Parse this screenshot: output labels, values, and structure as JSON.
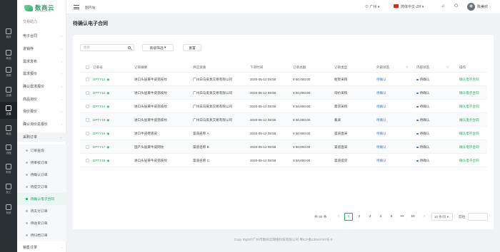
{
  "rail": [
    {
      "label": "首页",
      "icon": "home-icon"
    },
    {
      "label": "商品",
      "icon": "goods-icon"
    },
    {
      "label": "资质",
      "icon": "license-icon"
    },
    {
      "label": "店铺",
      "icon": "shop-icon"
    },
    {
      "label": "交易",
      "icon": "trade-icon"
    },
    {
      "label": "商品",
      "icon": "product-icon"
    },
    {
      "label": "流程",
      "icon": "flow-icon"
    },
    {
      "label": "财务",
      "icon": "finance-icon"
    },
    {
      "label": "加工",
      "icon": "process-icon"
    },
    {
      "label": "系统",
      "icon": "system-icon"
    }
  ],
  "brand": {
    "name": "数商云",
    "sub": "SHU SHANG YUN"
  },
  "menu": {
    "heading": "交易助力",
    "items": [
      {
        "label": "电子合同"
      },
      {
        "label": "进销存"
      },
      {
        "label": "需求发布"
      },
      {
        "label": "需求报价"
      },
      {
        "label": "确认需求报价"
      },
      {
        "label": "商品询价"
      },
      {
        "label": "询价报价"
      },
      {
        "label": "确认询价总报价"
      }
    ],
    "group": "采购订单",
    "sub_items": [
      {
        "label": "订单查询"
      },
      {
        "label": "待审核订单"
      },
      {
        "label": "待确认订单"
      },
      {
        "label": "待提交订单"
      },
      {
        "label": "待确认电子合同"
      },
      {
        "label": "待支付订单"
      },
      {
        "label": "待收货订单"
      },
      {
        "label": "待归档订单"
      }
    ],
    "last": "销售订单"
  },
  "topbar": {
    "station": "国内站",
    "location": "广州",
    "language": "简体中文-ZH",
    "username": "陈美欣"
  },
  "page": {
    "title": "待确认电子合同"
  },
  "toolbar": {
    "search_placeholder": "搜索",
    "advanced": "高级筛选",
    "reset": "重置"
  },
  "table": {
    "headers": [
      "订单号",
      "订单摘要",
      "供应资质",
      "下单时间",
      "订单总额",
      "订单类型",
      "外部状态",
      "内部状态",
      "操作"
    ],
    "rows": [
      {
        "id": "DPTY12",
        "summary": "进口头层黄牛皮荔枝纹",
        "supplier": "广州白马皮具交易有限公司",
        "time": "2020-05-12 08:58",
        "amount": "¥ 50,000.00",
        "type": "框架采购",
        "ext": "待确认",
        "int": "待确认",
        "action": "确认电子合同"
      },
      {
        "id": "DPTY13",
        "summary": "进口头层黄牛皮荔枝纹",
        "supplier": "广州白马皮具交易有限公司",
        "time": "2020-05-12 08:58",
        "amount": "¥ 50,000.00",
        "type": "询价采购",
        "ext": "待确认",
        "int": "待确认",
        "action": "确认电子合同"
      },
      {
        "id": "DPTY14",
        "summary": "进口头层黄牛皮荔枝纹",
        "supplier": "广州白马皮具交易有限公司",
        "time": "2020-05-12 08:58",
        "amount": "¥ 50,000.00",
        "type": "需求采购",
        "ext": "待确认",
        "int": "待确认",
        "action": "确认电子合同"
      },
      {
        "id": "DPTY15",
        "summary": "进口头层黄牛皮荔枝纹",
        "supplier": "广州白马皮具交易有限公司",
        "time": "2020-05-12 08:58",
        "amount": "¥ 50,000.00",
        "type": "集采",
        "ext": "待确认",
        "int": "待确认",
        "action": "确认电子合同"
      },
      {
        "id": "DPTY16",
        "summary": "进口牛皮鞋底皮",
        "supplier": "渠道名称 A",
        "time": "2020-05-12 08:58",
        "amount": "¥ 50,000.00",
        "type": "渠道直采",
        "ext": "待确认",
        "int": "待确认",
        "action": "确认电子合同"
      },
      {
        "id": "DPTY17",
        "summary": "国产头层黄牛皮网纹",
        "supplier": "渠道名称 B",
        "time": "2020-05-12 08:58",
        "amount": "¥ 50,000.00",
        "type": "渠道直采",
        "ext": "待确认",
        "int": "待确认",
        "action": "确认电子合同"
      },
      {
        "id": "DPTY18",
        "summary": "进口头层黄牛皮荔枝纹",
        "supplier": "渠道名称 C",
        "time": "2020-05-12 08:58",
        "amount": "¥ 50,000.00",
        "type": "渠道提货",
        "ext": "待确认",
        "int": "待确认",
        "action": "确认电子合同"
      }
    ]
  },
  "pagination": {
    "total": "共 80 条",
    "prev": "<",
    "pages": [
      "1",
      "2",
      "3",
      "4",
      "5",
      "•••",
      "10"
    ],
    "next": ">",
    "page_size": "10 条/页",
    "jump_label": "前往"
  },
  "footer": "Copy Right©广州市数商云网络科技有限公司 粤ICP备13044797号-5"
}
